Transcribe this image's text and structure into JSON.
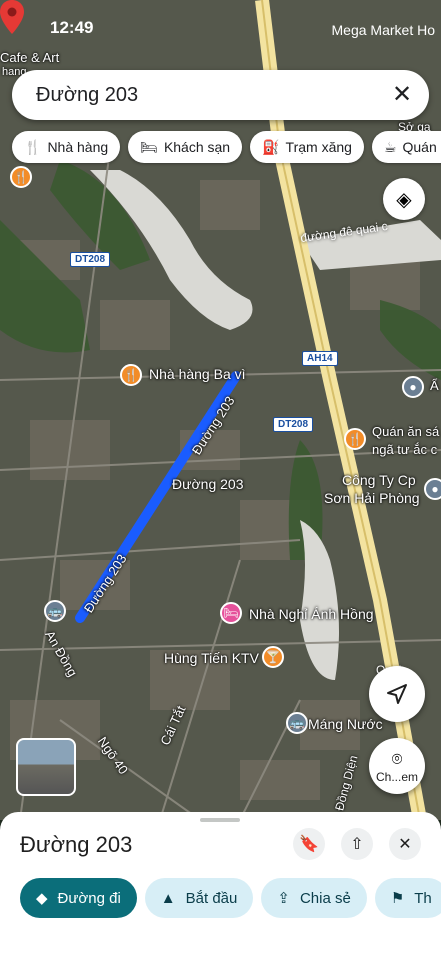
{
  "status_bar": {
    "time": "12:49",
    "right_text": "Mega Market Ho"
  },
  "search": {
    "query": "Đường 203"
  },
  "chips": [
    {
      "icon": "restaurant-icon",
      "label": "Nhà hàng"
    },
    {
      "icon": "hotel-icon",
      "label": "Khách sạn"
    },
    {
      "icon": "gas-station-icon",
      "label": "Trạm xăng"
    },
    {
      "icon": "coffee-icon",
      "label": "Quán c"
    }
  ],
  "map_labels": {
    "cafe": "Cafe & Art",
    "cafe_sub": "hang",
    "so_ga": "Sở ga",
    "quai": "đường đê quai c",
    "dt208_a": "DT208",
    "dt208_b": "DT208",
    "ah14": "AH14",
    "nha_hang_ba_vi": "Nhà hàng Ba vì",
    "duong_203_a": "Đường 203",
    "duong_203_b": "Đường 203",
    "duong_203_c": "Đường 203",
    "quan_an_1": "Quán ăn sá",
    "quan_an_2": "ngã tư ắc c",
    "cong_ty_1": "Công Ty Cp",
    "cong_ty_2": "Sơn Hải Phòng",
    "nha_nghi": "Nhà Nghỉ Ánh Hồng",
    "hung_tien": "Hùng Tiến KTV",
    "an_dong": "An Đồng",
    "cai_tat": "Cái Tắt",
    "ngo_40": "Ngõ 40",
    "mang_nuoc": "Máng Nước",
    "dong_dien": "Đồng Diện",
    "a_top": "Ẩ",
    "quai2": "Quai",
    "cho_em": "Ch...em"
  },
  "sheet": {
    "title": "Đường 203",
    "actions": [
      {
        "icon": "directions-icon",
        "label": "Đường đi"
      },
      {
        "icon": "navigation-arrow-icon",
        "label": "Bắt đầu"
      },
      {
        "icon": "share-icon",
        "label": "Chia sẻ"
      },
      {
        "icon": "flag-icon",
        "label": "Th"
      }
    ]
  },
  "colors": {
    "route": "#1a5cff",
    "pin": "#e53935",
    "primary_button": "#0b6e7a"
  }
}
